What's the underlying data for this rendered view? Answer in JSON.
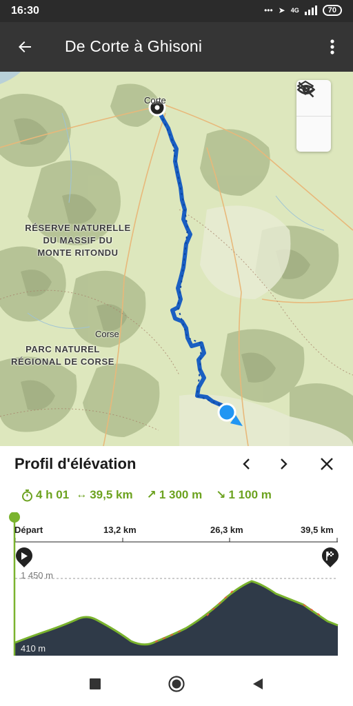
{
  "status_bar": {
    "time": "16:30",
    "network": "4G",
    "battery": "70"
  },
  "app_bar": {
    "title": "De Corte à Ghisoni"
  },
  "map": {
    "labels": {
      "corte": "Corte",
      "reserve": "RÉSERVE NATURELLE\nDU MASSIF DU\nMONTE RITONDU",
      "corse": "Corse",
      "parc": "PARC NATUREL\nRÉGIONAL DE CORSE"
    },
    "route_color": "#1565c0",
    "accent_position": "#2196f3"
  },
  "elevation": {
    "title": "Profil d'élévation",
    "duration": "4 h 01",
    "distance": "39,5 km",
    "ascent": "1 300 m",
    "descent": "1 100 m",
    "accent": "#6ca21f",
    "km_ticks": [
      "Départ",
      "13,2 km",
      "26,3 km",
      "39,5 km"
    ],
    "alt_max": "1 450 m",
    "alt_min": "410 m"
  },
  "icons": {
    "back": "arrow-left-icon",
    "more": "more-vertical-icon",
    "layers": "layers-icon",
    "visibility": "eye-off-icon",
    "prev": "chevron-left-icon",
    "next": "chevron-right-icon",
    "close": "close-icon"
  }
}
